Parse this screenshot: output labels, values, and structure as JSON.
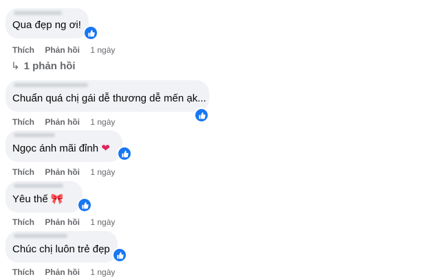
{
  "comments": [
    {
      "text": "Qua đẹp ng ơi!",
      "like": "Thích",
      "reply": "Phản hồi",
      "time": "1 ngày",
      "emoji": ""
    },
    {
      "text": "Chuẩn quá chị gái dễ thương dễ mến ạk...",
      "like": "Thích",
      "reply": "Phản hồi",
      "time": "1 ngày",
      "emoji": ""
    },
    {
      "text": "Ngọc ánh mãi đỉnh",
      "like": "Thích",
      "reply": "Phản hồi",
      "time": "1 ngày",
      "emoji": "❤"
    },
    {
      "text": "Yêu thế",
      "like": "Thích",
      "reply": "Phản hồi",
      "time": "1 ngày",
      "emoji": "🎀"
    },
    {
      "text": "Chúc chị luôn trẻ đẹp",
      "like": "Thích",
      "reply": "Phản hồi",
      "time": "1 ngày",
      "emoji": ""
    }
  ],
  "reply_link": {
    "count_label": "1 phản hồi",
    "icon": "reply-arrow-icon"
  },
  "colors": {
    "bubble": "#f0f2f5",
    "like_blue": "#1877f2",
    "meta_gray": "#65676b"
  }
}
